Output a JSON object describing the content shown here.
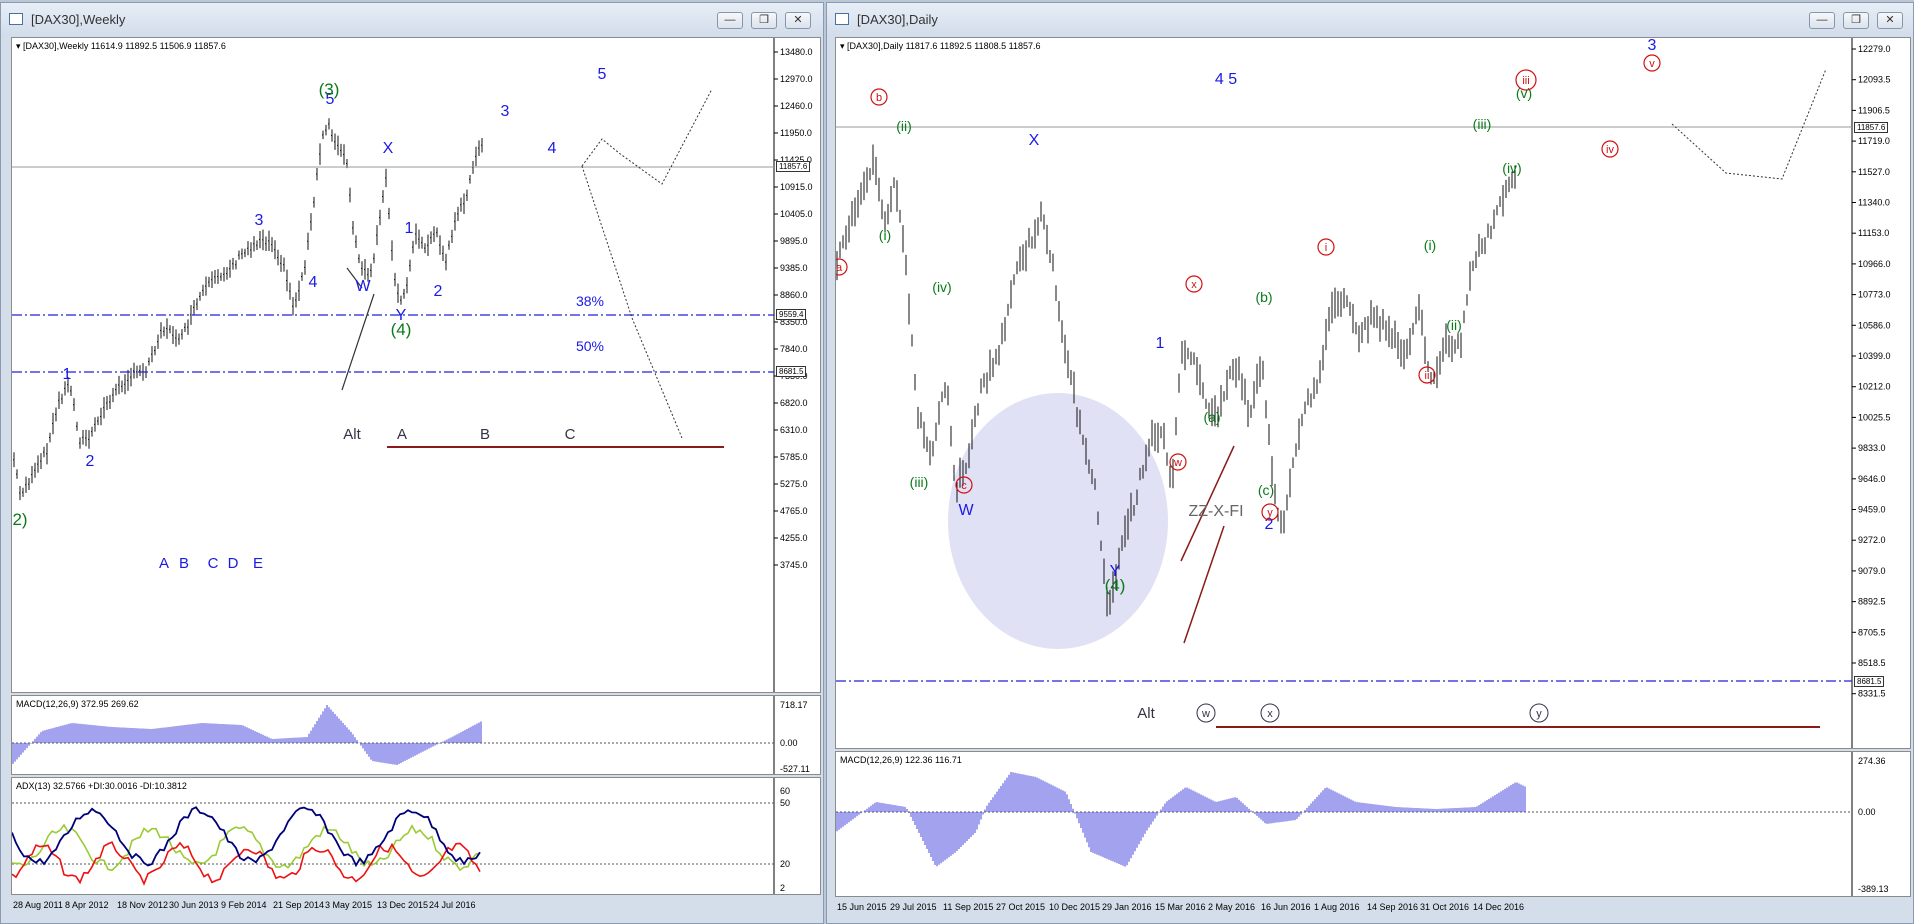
{
  "left_window": {
    "title": "[DAX30],Weekly",
    "header": "[DAX30],Weekly  11614.9 11892.5 11506.9 11857.6",
    "price_ticks": [
      "13480.0",
      "12970.0",
      "12460.0",
      "11950.0",
      "11425.0",
      "10915.0",
      "10405.0",
      "9895.0",
      "9385.0",
      "8860.0",
      "8350.0",
      "7840.0",
      "7330.0",
      "6820.0",
      "6310.0",
      "5785.0",
      "5275.0",
      "4765.0",
      "4255.0",
      "3745.0"
    ],
    "price_badges": [
      "11857.6",
      "9559.4",
      "8681.5"
    ],
    "fib_labels": [
      "38%",
      "50%"
    ],
    "wave_labels_blue": [
      "1",
      "2",
      "3",
      "4",
      "5",
      "X",
      "W",
      "Y",
      "1",
      "2",
      "3",
      "4",
      "5"
    ],
    "wave_labels_green": [
      "(3)",
      "(4)",
      "2)"
    ],
    "letters_bottom": [
      "A",
      "B",
      "C",
      "D",
      "E"
    ],
    "alt_labels": [
      "Alt",
      "A",
      "B",
      "C"
    ],
    "macd_header": "MACD(12,26,9) 372.95 269.62",
    "macd_ticks": [
      "718.17",
      "0.00",
      "-527.11"
    ],
    "adx_header": "ADX(13) 32.5766 +DI:30.0016 -DI:10.3812",
    "adx_ticks": [
      "60",
      "50",
      "20",
      "2"
    ],
    "time_axis": [
      "28 Aug 2011",
      "8 Apr 2012",
      "18 Nov 2012",
      "30 Jun 2013",
      "9 Feb 2014",
      "21 Sep 2014",
      "3 May 2015",
      "13 Dec 2015",
      "24 Jul 2016"
    ]
  },
  "right_window": {
    "title": "[DAX30],Daily",
    "header": "[DAX30],Daily  11817.6 11892.5 11808.5 11857.6",
    "price_ticks": [
      "12279.0",
      "12093.5",
      "11906.5",
      "11719.0",
      "11527.0",
      "11340.0",
      "11153.0",
      "10966.0",
      "10773.0",
      "10586.0",
      "10399.0",
      "10212.0",
      "10025.5",
      "9833.0",
      "9646.0",
      "9459.0",
      "9272.0",
      "9079.0",
      "8892.5",
      "8705.5",
      "8518.5",
      "8331.5"
    ],
    "price_badges": [
      "11857.6",
      "8681.5"
    ],
    "labels_blue": [
      "4 5",
      "3",
      "X",
      "W",
      "1",
      "2",
      "Y"
    ],
    "labels_green_roman": [
      "(ii)",
      "(i)",
      "(iv)",
      "(iii)",
      "(a)",
      "(b)",
      "(c)",
      "(i)",
      "(ii)",
      "(iii)",
      "(iv)",
      "(v)",
      "(4)"
    ],
    "labels_red_circled": [
      "a",
      "b",
      "c",
      "x",
      "w",
      "y",
      "i",
      "ii",
      "iii",
      "iv",
      "v"
    ],
    "zz_label": "ZZ-X-FI",
    "alt_labels": [
      "Alt",
      "w",
      "x",
      "y"
    ],
    "macd_header": "MACD(12,26,9) 122.36 116.71",
    "macd_ticks": [
      "274.36",
      "0.00",
      "-389.13"
    ],
    "time_axis": [
      "15 Jun 2015",
      "29 Jul 2015",
      "11 Sep 2015",
      "27 Oct 2015",
      "10 Dec 2015",
      "29 Jan 2016",
      "15 Mar 2016",
      "2 May 2016",
      "16 Jun 2016",
      "1 Aug 2016",
      "14 Sep 2016",
      "31 Oct 2016",
      "14 Dec 2016"
    ]
  },
  "window_buttons": {
    "minimize": "—",
    "restore": "❐",
    "close": "✕"
  }
}
